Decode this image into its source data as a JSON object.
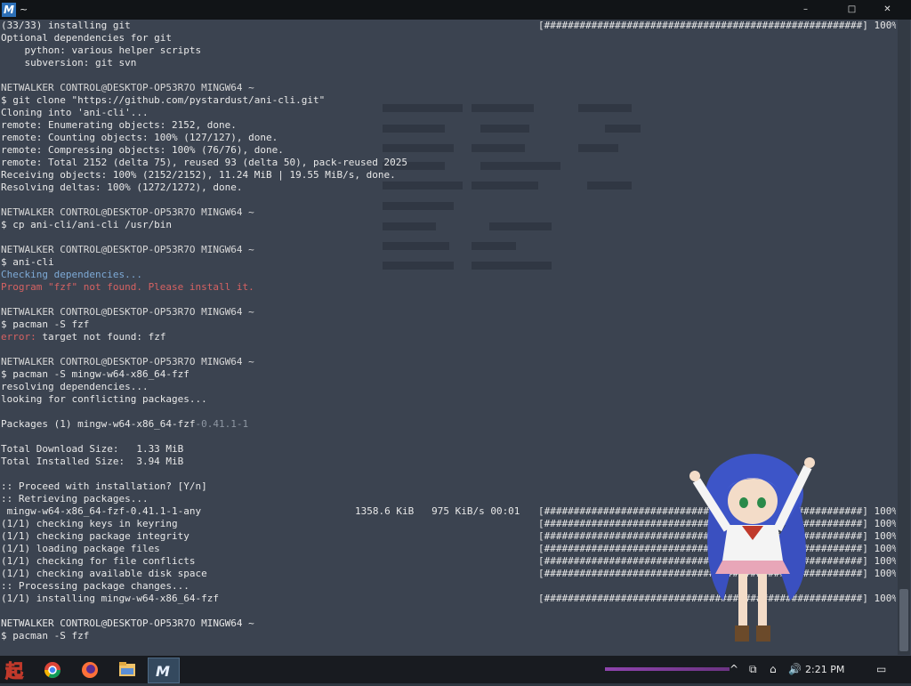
{
  "window": {
    "title": "~",
    "app_icon_letter": "M",
    "min_glyph": "–",
    "max_glyph": "□",
    "close_glyph": "✕"
  },
  "terminal": {
    "lines": [
      "(33/33) installing git",
      "Optional dependencies for git",
      "    python: various helper scripts",
      "    subversion: git svn",
      "",
      "NETWALKER CONTROL@DESKTOP-OP53R7O MINGW64 ~",
      "$ git clone \"https://github.com/pystardust/ani-cli.git\"",
      "Cloning into 'ani-cli'...",
      "remote: Enumerating objects: 2152, done.",
      "remote: Counting objects: 100% (127/127), done.",
      "remote: Compressing objects: 100% (76/76), done.",
      "remote: Total 2152 (delta 75), reused 93 (delta 50), pack-reused 2025",
      "Receiving objects: 100% (2152/2152), 11.24 MiB | 19.55 MiB/s, done.",
      "Resolving deltas: 100% (1272/1272), done.",
      "",
      "NETWALKER CONTROL@DESKTOP-OP53R7O MINGW64 ~",
      "$ cp ani-cli/ani-cli /usr/bin",
      "",
      "NETWALKER CONTROL@DESKTOP-OP53R7O MINGW64 ~",
      "$ ani-cli",
      "Checking dependencies...",
      "Program \"fzf\" not found. Please install it.",
      "",
      "NETWALKER CONTROL@DESKTOP-OP53R7O MINGW64 ~",
      "$ pacman -S fzf",
      "error: target not found: fzf",
      "",
      "NETWALKER CONTROL@DESKTOP-OP53R7O MINGW64 ~",
      "$ pacman -S mingw-w64-x86_64-fzf",
      "resolving dependencies...",
      "looking for conflicting packages...",
      "",
      "Packages (1) mingw-w64-x86_64-fzf",
      "",
      "Total Download Size:   1.33 MiB",
      "Total Installed Size:  3.94 MiB",
      "",
      ":: Proceed with installation? [Y/n]",
      ":: Retrieving packages...",
      " mingw-w64-x86_64-fzf-0.41.1-1-any",
      "(1/1) checking keys in keyring",
      "(1/1) checking package integrity",
      "(1/1) loading package files",
      "(1/1) checking for file conflicts",
      "(1/1) checking available disk space",
      ":: Processing package changes...",
      "(1/1) installing mingw-w64-x86_64-fzf",
      "",
      "NETWALKER CONTROL@DESKTOP-OP53R7O MINGW64 ~",
      "$ pacman -S fzf"
    ],
    "line_styles": {
      "5": "prompt",
      "15": "prompt",
      "18": "prompt",
      "23": "prompt",
      "27": "prompt",
      "47": "prompt",
      "20": "warn",
      "21": "err"
    },
    "error_prefix": "error:",
    "packages_version_suffix": "-0.41.1-1",
    "download_stats": "1358.6 KiB   975 KiB/s 00:01",
    "progress_bar": "[######################################################] 100%",
    "progress_rows": [
      0,
      39,
      40,
      41,
      42,
      43,
      44,
      46
    ]
  },
  "taskbar": {
    "start_label": "起",
    "clock": "2:21 PM",
    "tray_icons": [
      "^",
      "⧉",
      "⌂",
      "🔊"
    ],
    "notification_glyph": "▭"
  },
  "colors": {
    "terminal_bg": "#3b4350",
    "prompt": "#d8d8d8",
    "warning": "#7eaad6",
    "error": "#d66262",
    "taskbar_bg": "#181b20"
  }
}
